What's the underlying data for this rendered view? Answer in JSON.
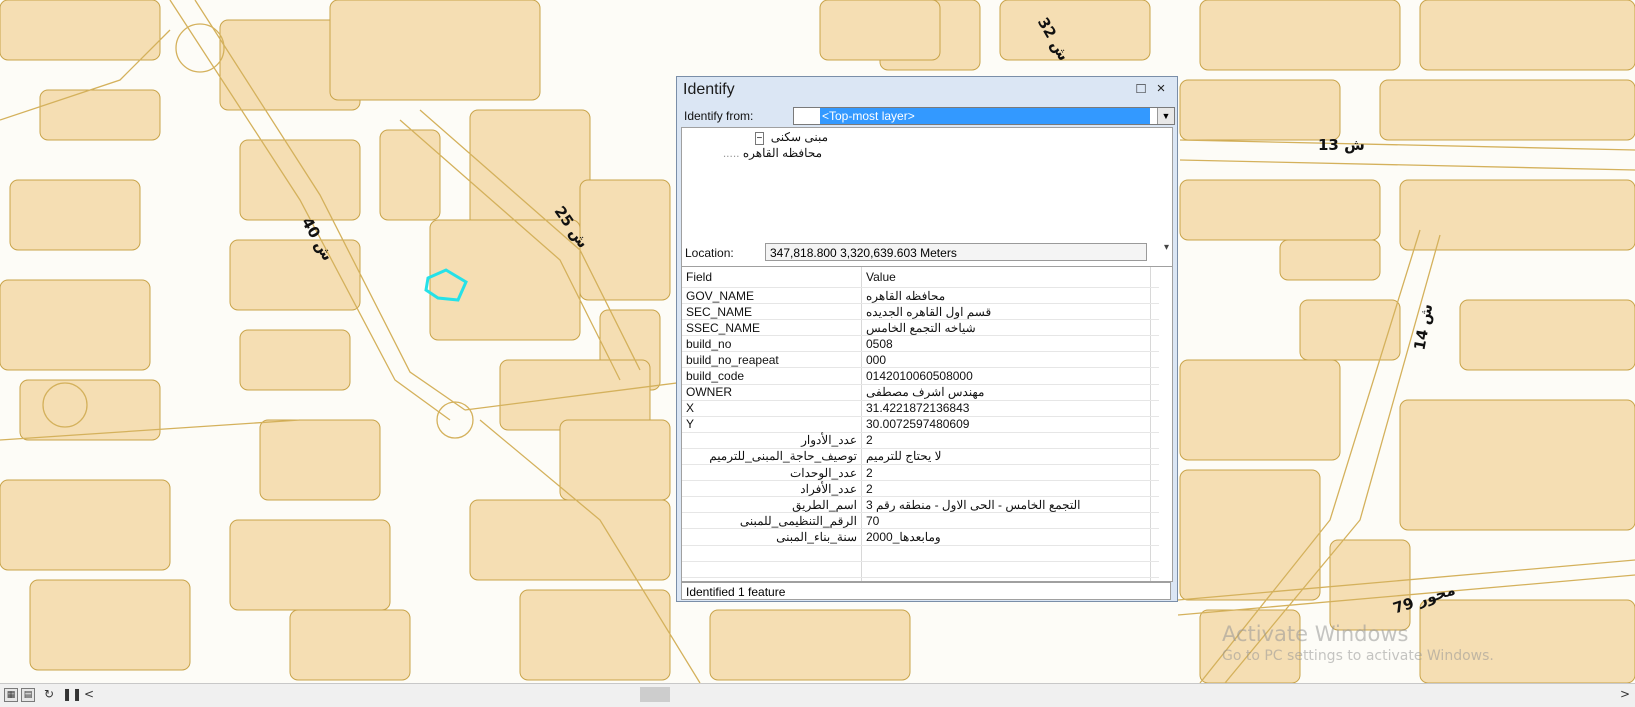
{
  "map": {
    "road_labels": [
      "ش 32",
      "ش 13",
      "ش 40",
      "ش 25",
      "ش 14",
      "محور 79"
    ],
    "colors": {
      "parcel_fill": "#f5deb3",
      "parcel_stroke": "#c9a44a",
      "road_line": "#d4b15c",
      "selection": "#25e1e8"
    }
  },
  "watermark": {
    "line1": "Activate Windows",
    "line2": "Go to PC settings to activate Windows."
  },
  "statusbar": {
    "icons": [
      "layout-view-icon",
      "data-view-icon",
      "refresh-icon",
      "pause-icon"
    ],
    "scroll_left": "<",
    "scroll_right": ">"
  },
  "identify": {
    "title": "Identify",
    "title_buttons": {
      "restore": "□",
      "close": "×"
    },
    "identify_from_label": "Identify from:",
    "identify_from_value": "<Top-most layer>",
    "tree": {
      "layer": "مبنى سكنى",
      "feature": "محافظه القاهره"
    },
    "location_label": "Location:",
    "location_value": "347,818.800  3,320,639.603 Meters",
    "columns": {
      "field": "Field",
      "value": "Value"
    },
    "rows": [
      {
        "field": "GOV_NAME",
        "value": "محافظه القاهره"
      },
      {
        "field": "SEC_NAME",
        "value": "قسم اول القاهره الجديده"
      },
      {
        "field": "SSEC_NAME",
        "value": "شياخه التجمع الخامس"
      },
      {
        "field": "build_no",
        "value": "0508"
      },
      {
        "field": "build_no_reapeat",
        "value": "000"
      },
      {
        "field": "build_code",
        "value": "0142010060508000"
      },
      {
        "field": "OWNER",
        "value": "مهندس اشرف مصطفى"
      },
      {
        "field": "X",
        "value": "31.4221872136843"
      },
      {
        "field": "Y",
        "value": "30.0072597480609"
      },
      {
        "field": "عدد_الأدوار",
        "value": "2"
      },
      {
        "field": "توصيف_حاجة_المبنى_للترميم",
        "value": "لا يحتاج للترميم"
      },
      {
        "field": "عدد_الوحدات",
        "value": "2"
      },
      {
        "field": "عدد_الأفراد",
        "value": "2"
      },
      {
        "field": "اسم_الطريق",
        "value": "التجمع الخامس - الحى الاول - منطقه رقم 3"
      },
      {
        "field": "الرقم_التنظيمى_للمبنى",
        "value": "70"
      },
      {
        "field": "سنة_بناء_المبنى",
        "value": "ومابعدها_2000"
      }
    ],
    "footer": "Identified 1 feature"
  }
}
